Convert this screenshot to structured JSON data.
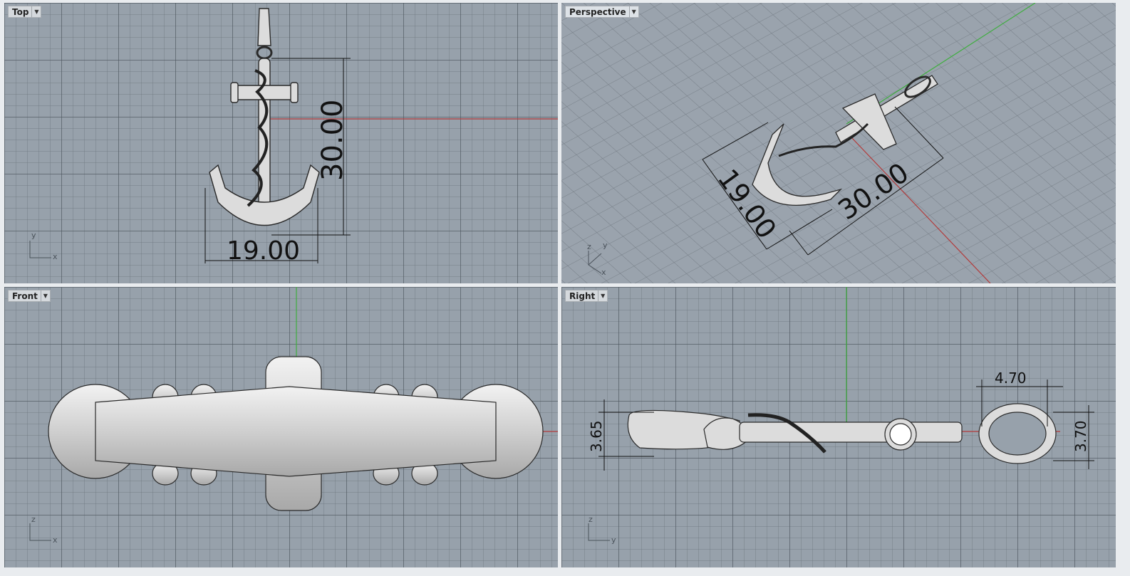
{
  "viewports": {
    "top": {
      "label": "Top",
      "dims": {
        "vertical": "30.00",
        "horizontal": "19.00"
      },
      "axes": {
        "a": "y",
        "b": "x"
      }
    },
    "perspective": {
      "label": "Perspective",
      "dims": {
        "width": "19.00",
        "length": "30.00"
      },
      "axes": {
        "a": "z",
        "b": "y",
        "c": "x"
      }
    },
    "front": {
      "label": "Front",
      "axes": {
        "a": "z",
        "b": "x"
      }
    },
    "right": {
      "label": "Right",
      "dims": {
        "loop_width": "4.70",
        "loop_height": "3.70",
        "body_height": "3.65"
      },
      "axes": {
        "a": "z",
        "b": "y"
      }
    }
  },
  "colors": {
    "grid_bg": "#97a1ab",
    "x_axis": "#b33a3a",
    "y_axis": "#3fae3f",
    "model": "#dcdcdc",
    "active_label": "#dde2e7"
  },
  "icons": {
    "menu": "chevron-down-icon"
  }
}
